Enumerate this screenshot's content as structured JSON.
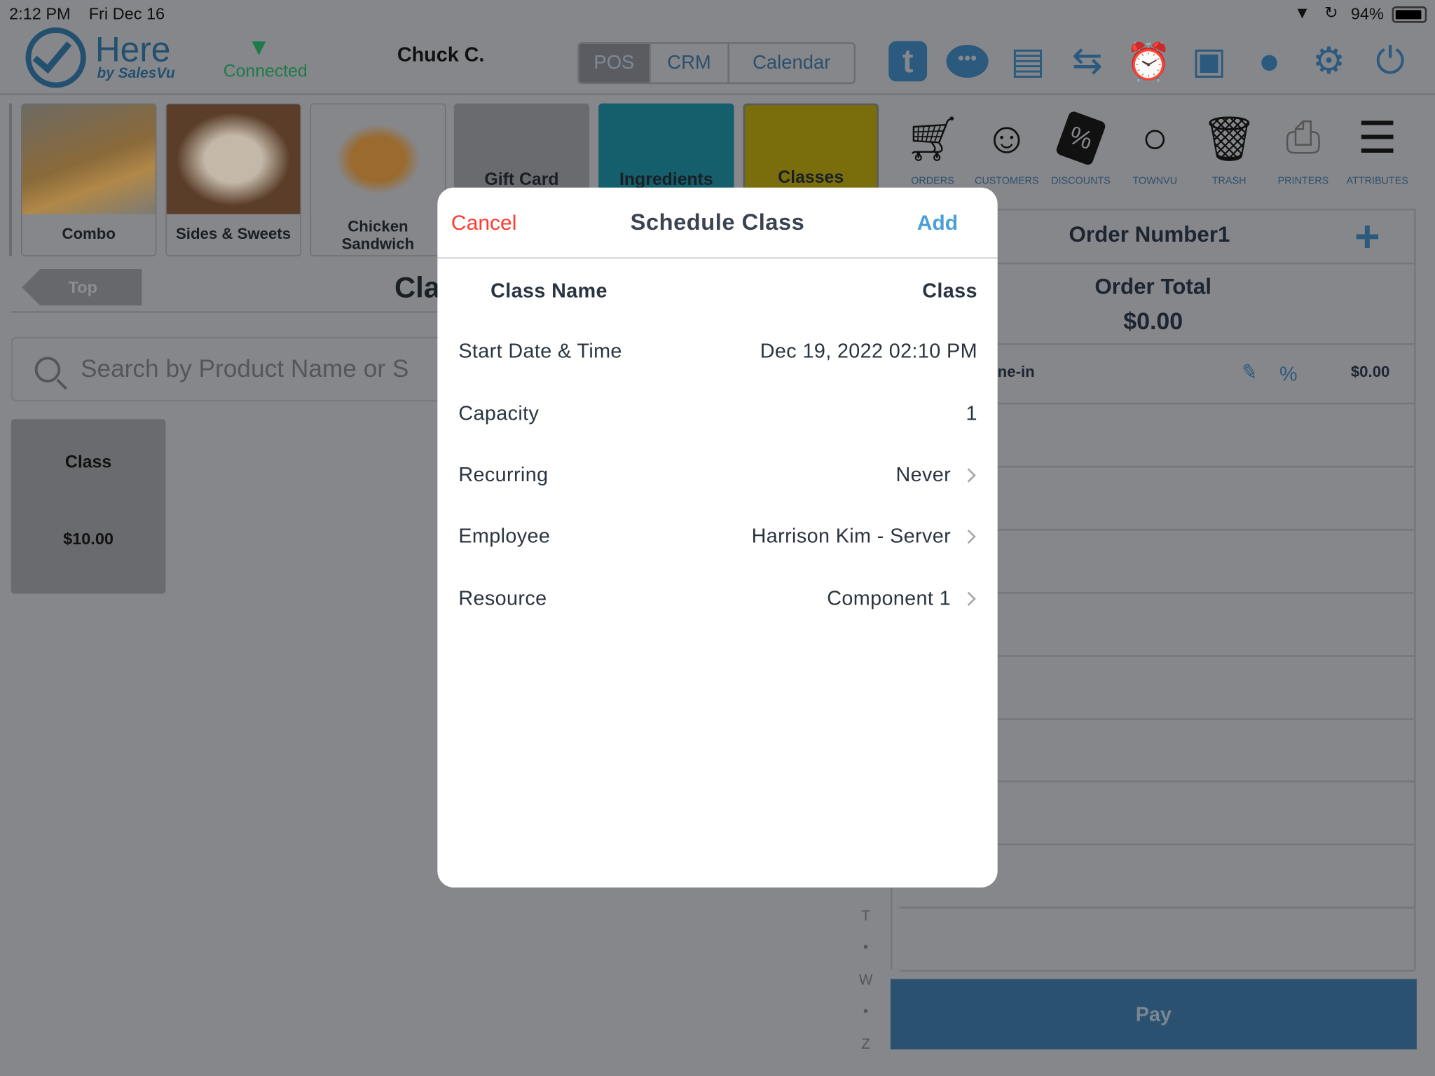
{
  "status_bar": {
    "time": "2:12 PM",
    "date": "Fri Dec 16",
    "battery": "94%"
  },
  "header": {
    "logo_main": "Here",
    "logo_sub": "by SalesVu",
    "connection": "Connected",
    "user": "Chuck C.",
    "segments": [
      {
        "label": "POS",
        "active": true
      },
      {
        "label": "CRM",
        "active": false
      },
      {
        "label": "Calendar",
        "active": false
      }
    ],
    "icons": [
      "timeclock-settings-icon",
      "chat-icon",
      "cash-drawer-icon",
      "transfer-icon",
      "alarm-clock-icon",
      "wallet-icon",
      "piggy-bank-icon",
      "gear-icon",
      "logout-icon"
    ]
  },
  "tools": [
    {
      "label": "ORDERS",
      "icon": "cart-icon"
    },
    {
      "label": "CUSTOMERS",
      "icon": "add-customer-icon"
    },
    {
      "label": "DISCOUNTS",
      "icon": "discount-tag-icon"
    },
    {
      "label": "TOWNVU",
      "icon": "townvu-icon"
    },
    {
      "label": "TRASH",
      "icon": "trash-icon"
    },
    {
      "label": "PRINTERS",
      "icon": "printer-icon"
    },
    {
      "label": "ATTRIBUTES",
      "icon": "clipboard-icon"
    }
  ],
  "categories": [
    {
      "label": "Combo"
    },
    {
      "label": "Sides & Sweets"
    },
    {
      "label": "Chicken Sandwich"
    },
    {
      "label": "Gift Card",
      "color": "#6a6b6f"
    },
    {
      "label": "Ingredients",
      "color": "#145f6b"
    },
    {
      "label": "Classes",
      "color": "#7a6d0c"
    }
  ],
  "nav": {
    "back_label": "Top",
    "title": "Cla"
  },
  "search": {
    "placeholder": "Search by Product Name or S"
  },
  "products": [
    {
      "name": "Class",
      "price": "$10.00"
    }
  ],
  "index": [
    "T",
    "•",
    "W",
    "•",
    "Z"
  ],
  "order": {
    "title": "Order Number1",
    "total_label": "Order Total",
    "total": "$0.00",
    "line_label": "ne-in",
    "line_amount": "$0.00",
    "percent": "%",
    "pay_label": "Pay"
  },
  "modal": {
    "title": "Schedule Class",
    "cancel": "Cancel",
    "add": "Add",
    "rows": [
      {
        "label": "Class Name",
        "value": "Class"
      },
      {
        "label": "Start Date & Time",
        "value": "Dec 19, 2022 02:10 PM"
      },
      {
        "label": "Capacity",
        "value": "1"
      },
      {
        "label": "Recurring",
        "value": "Never"
      },
      {
        "label": "Employee",
        "value": "Harrison Kim - Server"
      },
      {
        "label": "Resource",
        "value": "Component 1"
      }
    ]
  },
  "colors": {
    "brand": "#2b5a7e",
    "cancel": "#ff3b30",
    "add": "#4a9fd8",
    "pay": "#2a5270",
    "connected": "#1f7a4a"
  }
}
